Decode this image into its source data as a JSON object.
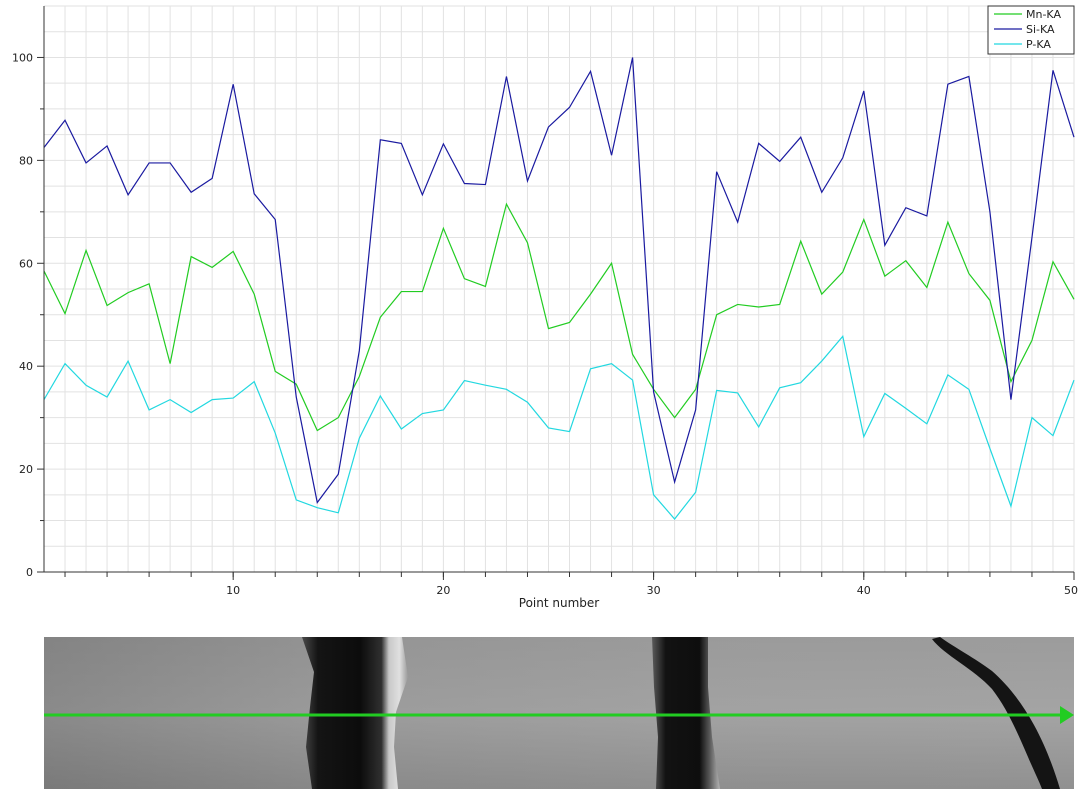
{
  "chart_data": {
    "type": "line",
    "title": "",
    "xlabel": "Point number",
    "ylabel": "",
    "xlim": [
      1,
      50
    ],
    "ylim": [
      0,
      110
    ],
    "x_ticks": [
      10,
      20,
      30,
      40,
      50
    ],
    "y_ticks": [
      0,
      20,
      40,
      60,
      80,
      100
    ],
    "grid": true,
    "legend": "top-right",
    "x": [
      1,
      2,
      3,
      4,
      5,
      6,
      7,
      8,
      9,
      10,
      11,
      12,
      13,
      14,
      15,
      16,
      17,
      18,
      19,
      20,
      21,
      22,
      23,
      24,
      25,
      26,
      27,
      28,
      29,
      30,
      31,
      32,
      33,
      34,
      35,
      36,
      37,
      38,
      39,
      40,
      41,
      42,
      43,
      44,
      45,
      46,
      47,
      48,
      49,
      50
    ],
    "series": [
      {
        "name": "Mn-KA",
        "color": "#22cc22",
        "values": [
          58.5,
          50.2,
          62.5,
          51.8,
          54.3,
          56,
          40.5,
          61.3,
          59.2,
          62.3,
          54,
          39,
          36.5,
          27.5,
          30,
          38,
          49.5,
          54.5,
          54.5,
          66.8,
          57,
          55.5,
          71.5,
          64,
          47.3,
          48.5,
          54,
          60,
          42.3,
          35.5,
          30,
          35.5,
          50,
          52,
          51.5,
          52,
          64.3,
          54,
          58.3,
          68.5,
          57.5,
          60.5,
          55.3,
          68,
          58,
          52.8,
          37,
          45,
          60.3,
          53
        ]
      },
      {
        "name": "Si-KA",
        "color": "#1a1aa0",
        "values": [
          82.5,
          87.8,
          79.5,
          82.8,
          73.3,
          79.5,
          79.5,
          73.8,
          76.5,
          94.8,
          73.5,
          68.5,
          34,
          13.5,
          19,
          43,
          84,
          83.3,
          73.3,
          83.2,
          75.5,
          75.3,
          96.3,
          76,
          86.5,
          90.3,
          97.3,
          81,
          100,
          35,
          17.5,
          31.5,
          77.8,
          68,
          83.3,
          79.8,
          84.5,
          73.8,
          80.5,
          93.5,
          63.5,
          70.8,
          69.2,
          94.8,
          96.3,
          70,
          33.5,
          65,
          97.5,
          84.5
        ]
      },
      {
        "name": "P-KA",
        "color": "#22d8e0",
        "values": [
          33.5,
          40.5,
          36.3,
          34,
          41,
          31.5,
          33.5,
          31,
          33.5,
          33.8,
          37,
          27,
          14,
          12.5,
          11.5,
          26,
          34.2,
          27.8,
          30.8,
          31.5,
          37.2,
          36.3,
          35.5,
          33,
          28,
          27.3,
          39.5,
          40.5,
          37.3,
          15,
          10.3,
          15.5,
          35.3,
          34.8,
          28.2,
          35.8,
          36.8,
          41,
          45.8,
          26.3,
          34.7,
          31.8,
          28.8,
          38.3,
          35.5,
          24,
          12.8,
          30,
          26.5,
          37.3
        ]
      }
    ]
  },
  "micrograph": {
    "scan_line_color": "#22cc22"
  }
}
